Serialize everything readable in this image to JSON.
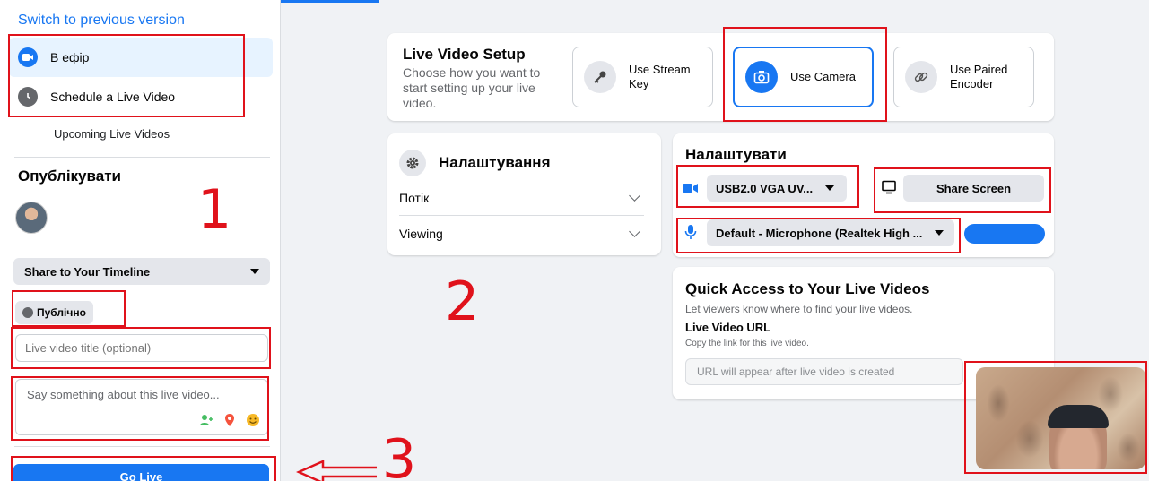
{
  "sidebar": {
    "switch_link": "Switch to previous version",
    "items": [
      {
        "label": "В ефір",
        "icon": "live-video-icon"
      },
      {
        "label": "Schedule a Live Video",
        "icon": "clock-icon"
      }
    ],
    "upcoming": "Upcoming Live Videos",
    "publish_title": "Опублікувати",
    "share_select": "Share to Your Timeline",
    "audience": "Публічно",
    "title_placeholder": "Live video title (optional)",
    "desc_placeholder": "Say something about this live video...",
    "go_live": "Go Live"
  },
  "setup": {
    "title": "Live Video Setup",
    "subtitle": "Choose how you want to start setting up your live video.",
    "options": [
      {
        "label": "Use Stream Key",
        "icon": "key-icon"
      },
      {
        "label": "Use Camera",
        "icon": "camera-icon",
        "selected": true
      },
      {
        "label": "Use Paired Encoder",
        "icon": "link-icon"
      }
    ]
  },
  "settings": {
    "title": "Налаштування",
    "rows": [
      "Потік",
      "Viewing"
    ]
  },
  "configure": {
    "title": "Налаштувати",
    "camera_select": "USB2.0 VGA UV...",
    "share_screen": "Share Screen",
    "mic_select": "Default - Microphone (Realtek High ..."
  },
  "quick_access": {
    "title": "Quick Access to Your Live Videos",
    "subtitle": "Let viewers know where to find your live videos.",
    "url_label": "Live Video URL",
    "url_hint": "Copy the link for this live video.",
    "url_placeholder": "URL will appear after live video is created"
  },
  "annotations": [
    "1",
    "2",
    "3"
  ],
  "colors": {
    "accent": "#1877f2",
    "annotation": "#e0121b"
  }
}
